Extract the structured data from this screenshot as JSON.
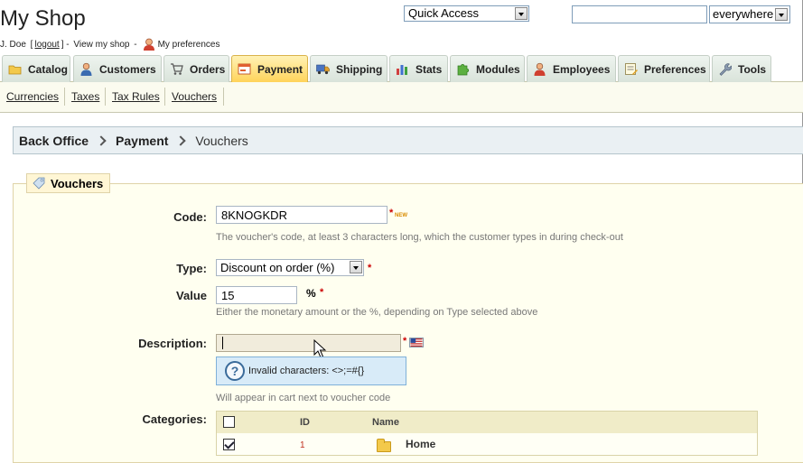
{
  "header": {
    "shop_name": "My Shop",
    "user_name": "J. Doe",
    "logout_label": "logout",
    "view_shop_label": "View my shop",
    "preferences_label": "My preferences",
    "quick_access_label": "Quick Access",
    "search_value": "",
    "search_scope": "everywhere"
  },
  "tabs": [
    {
      "label": "Catalog",
      "icon": "folder-icon",
      "active": false
    },
    {
      "label": "Customers",
      "icon": "user-icon",
      "active": false
    },
    {
      "label": "Orders",
      "icon": "cart-icon",
      "active": false
    },
    {
      "label": "Payment",
      "icon": "payment-icon",
      "active": true
    },
    {
      "label": "Shipping",
      "icon": "truck-icon",
      "active": false
    },
    {
      "label": "Stats",
      "icon": "bar-chart-icon",
      "active": false
    },
    {
      "label": "Modules",
      "icon": "puzzle-icon",
      "active": false
    },
    {
      "label": "Employees",
      "icon": "employee-icon",
      "active": false
    },
    {
      "label": "Preferences",
      "icon": "settings-form-icon",
      "active": false
    },
    {
      "label": "Tools",
      "icon": "wrench-icon",
      "active": false
    }
  ],
  "subnav": [
    "Currencies",
    "Taxes",
    "Tax Rules",
    "Vouchers"
  ],
  "breadcrumb": {
    "root": "Back Office",
    "section": "Payment",
    "current": "Vouchers"
  },
  "form": {
    "legend": "Vouchers",
    "code_label": "Code:",
    "code_value": "8KNOGKDR",
    "code_hint": "The voucher's code, at least 3 characters long, which the customer types in during check-out",
    "new_badge": "NEW",
    "required_mark": "*",
    "type_label": "Type:",
    "type_value": "Discount on order (%)",
    "value_label": "Value",
    "value_value": "15",
    "value_unit": "%",
    "value_hint": "Either the monetary amount or the %, depending on Type selected above",
    "description_label": "Description:",
    "description_value": "",
    "invalid_chars_tip": "Invalid characters: <>;=#{}",
    "description_hint": "Will appear in cart next to voucher code",
    "categories_label": "Categories:",
    "categories_columns": {
      "id": "ID",
      "name": "Name"
    },
    "categories_rows": [
      {
        "id": "1",
        "name": "Home",
        "checked": true
      }
    ]
  },
  "colors": {
    "active_tab": "#ffd35a",
    "tab": "#d9e3da",
    "tip_bg": "#d8ebf8",
    "required": "#cc0000"
  }
}
